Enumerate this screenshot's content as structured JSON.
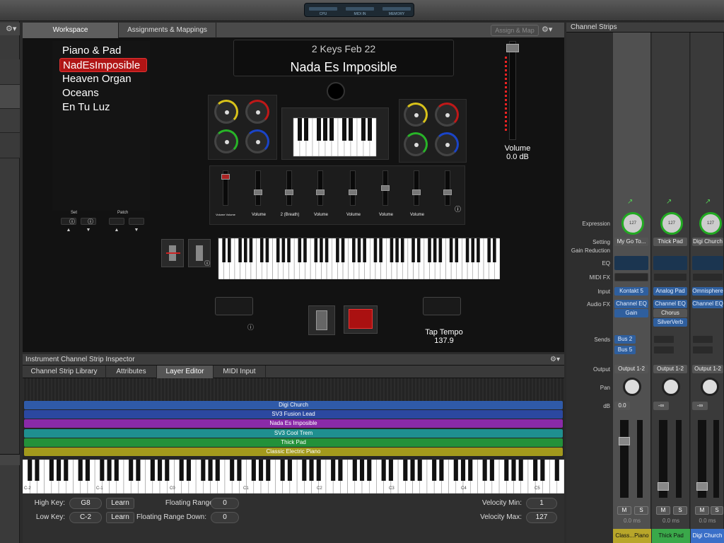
{
  "lcd": {
    "segments": [
      "CPU",
      "MIDI IN",
      "MEMORY"
    ]
  },
  "workspace_tabs": [
    {
      "label": "Workspace"
    },
    {
      "label": "Assignments & Mappings"
    }
  ],
  "assign_map_label": "Assign & Map",
  "display": {
    "line1": "2 Keys Feb 22",
    "line2": "Nada Es Imposible"
  },
  "patches": [
    "Piano & Pad",
    "NadEsImposible",
    "Heaven Organ",
    "Oceans",
    "En Tu Luz"
  ],
  "selected_patch_index": 1,
  "set_label": "Set",
  "patch_label": "Patch",
  "fader_labels": [
    "Volume Volume",
    "Volume",
    "2 (Breath)",
    "Volume",
    "Volume",
    "Volume",
    "Volume"
  ],
  "volume": {
    "label": "Volume",
    "value": "0.0 dB"
  },
  "tap_tempo": {
    "label": "Tap Tempo",
    "value": "137.9"
  },
  "inspector": {
    "title": "Instrument Channel Strip Inspector",
    "tabs": [
      "Channel Strip Library",
      "Attributes",
      "Layer Editor",
      "MIDI Input"
    ],
    "active_tab_index": 2,
    "layers": [
      {
        "name": "Digi Church",
        "color": "#2f5aa8"
      },
      {
        "name": "SV3 Fusion Lead",
        "color": "#2b48a0"
      },
      {
        "name": "Nada Es Imposible",
        "color": "#8a2aa8"
      },
      {
        "name": "SV3 Cool Trem",
        "color": "#1f8f8f"
      },
      {
        "name": "Thick Pad",
        "color": "#23913a"
      },
      {
        "name": "Classic Electric Piano",
        "color": "#a39a1c"
      }
    ],
    "octave_labels": [
      "C-2",
      "C-1",
      "C0",
      "C1",
      "C2",
      "C3",
      "C4",
      "C5"
    ],
    "high_key": {
      "label": "High Key:",
      "value": "G8"
    },
    "low_key": {
      "label": "Low Key:",
      "value": "C-2"
    },
    "learn_label": "Learn",
    "floating_up": {
      "label": "Floating Range Up:",
      "value": "0"
    },
    "floating_down": {
      "label": "Floating Range Down:",
      "value": "0"
    },
    "velocity_min": {
      "label": "Velocity Min:",
      "value": "1"
    },
    "velocity_max": {
      "label": "Velocity Max:",
      "value": "127"
    }
  },
  "channel_strips": {
    "title": "Channel Strips",
    "row_labels": {
      "expression": "Expression",
      "setting": "Setting",
      "gain_reduction": "Gain Reduction",
      "eq": "EQ",
      "midi_fx": "MIDI FX",
      "input": "Input",
      "audio_fx": "Audio FX",
      "sends": "Sends",
      "output": "Output",
      "pan": "Pan",
      "db": "dB"
    },
    "strips": [
      {
        "expression": "127",
        "setting": "My Go To...",
        "input": "Kontakt 5",
        "audio_fx": [
          "Channel EQ",
          "Gain"
        ],
        "sends": [
          "Bus 2",
          "Bus 5"
        ],
        "output": "Output 1-2",
        "db": "0.0",
        "time": "0.0 ms",
        "name": "Class...Piano",
        "name_color": "#b8a62a"
      },
      {
        "expression": "127",
        "setting": "Thick Pad",
        "input": "Analog Pad",
        "audio_fx": [
          "Channel EQ",
          "Chorus",
          "SilverVerb"
        ],
        "sends": [],
        "output": "Output 1-2",
        "db": "-∞",
        "time": "0.0 ms",
        "name": "Thick Pad",
        "name_color": "#3aa84a"
      },
      {
        "expression": "127",
        "setting": "Digi Church",
        "input": "Omnisphere",
        "audio_fx": [
          "Channel EQ"
        ],
        "sends": [],
        "output": "Output 1-2",
        "db": "-∞",
        "time": "0.0 ms",
        "name": "Digi Church",
        "name_color": "#3a6fc8"
      }
    ],
    "mute_label": "M",
    "solo_label": "S"
  },
  "colors": {
    "accent_red": "#b01515",
    "knob_yellow": "#d8c21a",
    "knob_red": "#c01818",
    "knob_green": "#28b428",
    "knob_blue": "#1a44c8"
  }
}
